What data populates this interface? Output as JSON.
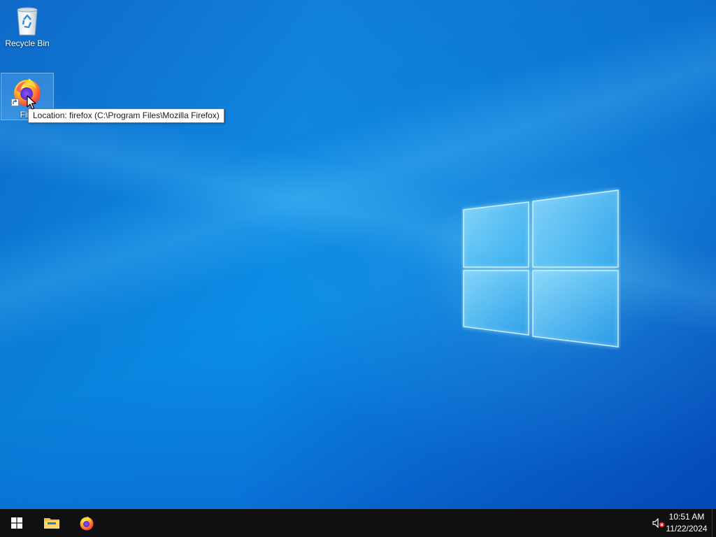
{
  "desktop": {
    "icons": [
      {
        "label": "Recycle Bin",
        "icon": "recycle-bin-icon"
      },
      {
        "label": "Firefox",
        "label_visible": "Fire",
        "icon": "firefox-icon",
        "shortcut": true
      }
    ],
    "tooltip": "Location: firefox (C:\\Program Files\\Mozilla Firefox)"
  },
  "taskbar": {
    "pinned": [
      {
        "name": "start-button",
        "icon": "windows-icon"
      },
      {
        "name": "file-explorer",
        "icon": "folder-icon"
      },
      {
        "name": "firefox",
        "icon": "firefox-icon"
      }
    ],
    "tray": {
      "volume_icon": "volume-muted-icon",
      "time": "10:51 AM",
      "date": "11/22/2024"
    }
  },
  "colors": {
    "wallpaper_accent": "#0b8ee6",
    "taskbar": "#101010",
    "tooltip_bg": "#ffffff"
  }
}
